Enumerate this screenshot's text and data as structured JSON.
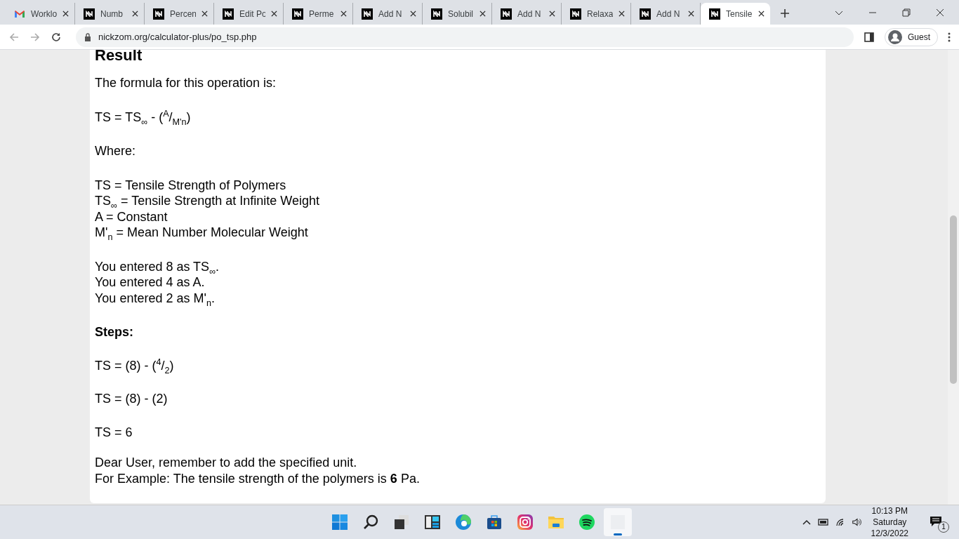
{
  "browser": {
    "tabs": [
      {
        "kind": "gmail",
        "label": "Worklo",
        "selected": false
      },
      {
        "kind": "site",
        "label": "Numb",
        "selected": false
      },
      {
        "kind": "site",
        "label": "Percen",
        "selected": false
      },
      {
        "kind": "site",
        "label": "Edit Po",
        "selected": false
      },
      {
        "kind": "site",
        "label": "Perme",
        "selected": false
      },
      {
        "kind": "site",
        "label": "Add N",
        "selected": false
      },
      {
        "kind": "site",
        "label": "Solubil",
        "selected": false
      },
      {
        "kind": "site",
        "label": "Add N",
        "selected": false
      },
      {
        "kind": "site",
        "label": "Relaxa",
        "selected": false
      },
      {
        "kind": "site",
        "label": "Add N",
        "selected": false
      },
      {
        "kind": "site",
        "label": "Tensile",
        "selected": true
      }
    ],
    "address": "nickzom.org/calculator-plus/po_tsp.php",
    "profile": "Guest"
  },
  "page": {
    "title": "Result",
    "intro": "The formula for this operation is:",
    "formula": "TS = TS$_{∞}$ - ($^{A}$/$_{M'n}$)",
    "where_label": "Where:",
    "definitions": [
      "TS = Tensile Strength of Polymers",
      "TS$_{∞}$ = Tensile Strength at Infinite Weight",
      "A = Constant",
      "M'$_{n}$ = Mean Number Molecular Weight"
    ],
    "entered": [
      "You entered 8 as TS$_{∞}$.",
      "You entered 4 as A.",
      "You entered 2 as M'$_{n}$."
    ],
    "steps_title": "Steps:",
    "steps": [
      "TS = (8) - ($^{4}$/$_{2}$)",
      "TS = (8) - (2)",
      "TS = 6"
    ],
    "note": [
      "Dear User, remember to add the specified unit.",
      "For Example: The tensile strength of the polymers is **6** Pa."
    ]
  },
  "taskbar": {
    "apps": [
      {
        "kind": "start",
        "selected": false
      },
      {
        "kind": "search",
        "selected": false
      },
      {
        "kind": "taskview",
        "selected": false
      },
      {
        "kind": "widgets",
        "selected": false
      },
      {
        "kind": "edge",
        "selected": false
      },
      {
        "kind": "store",
        "selected": false
      },
      {
        "kind": "instagram",
        "selected": false
      },
      {
        "kind": "files",
        "selected": false
      },
      {
        "kind": "spotify",
        "selected": false
      },
      {
        "kind": "blank",
        "selected": true
      }
    ],
    "time": "10:13 PM",
    "day": "Saturday",
    "date": "12/3/2022",
    "notifications": "1"
  }
}
